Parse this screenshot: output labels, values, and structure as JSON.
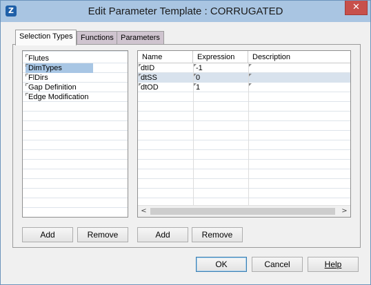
{
  "window": {
    "title": "Edit Parameter Template : CORRUGATED",
    "close_label": "✕",
    "icon_glyph": "Z"
  },
  "tabs": [
    {
      "label": "Selection Types",
      "active": true
    },
    {
      "label": "Functions",
      "active": false
    },
    {
      "label": "Parameters",
      "active": false
    }
  ],
  "selection_types": {
    "items": [
      "Flutes",
      "DimTypes",
      "FlDirs",
      "Gap Definition",
      "Edge Modification"
    ],
    "selected_index": 1,
    "add_label": "Add",
    "remove_label": "Remove"
  },
  "parameters_grid": {
    "columns": [
      "Name",
      "Expression",
      "Description"
    ],
    "rows": [
      {
        "name": "dtID",
        "expression": "-1",
        "description": ""
      },
      {
        "name": "dtSS",
        "expression": "0",
        "description": ""
      },
      {
        "name": "dtOD",
        "expression": "1",
        "description": ""
      }
    ],
    "scroll_left_glyph": "<",
    "scroll_right_glyph": ">",
    "add_label": "Add",
    "remove_label": "Remove"
  },
  "footer": {
    "ok_label": "OK",
    "cancel_label": "Cancel",
    "help_label": "Help"
  },
  "colors": {
    "titlebar": "#a9c5e2",
    "close": "#c7504b",
    "selection": "#a8c6e4",
    "inactive_tab": "#cfc4cf"
  }
}
